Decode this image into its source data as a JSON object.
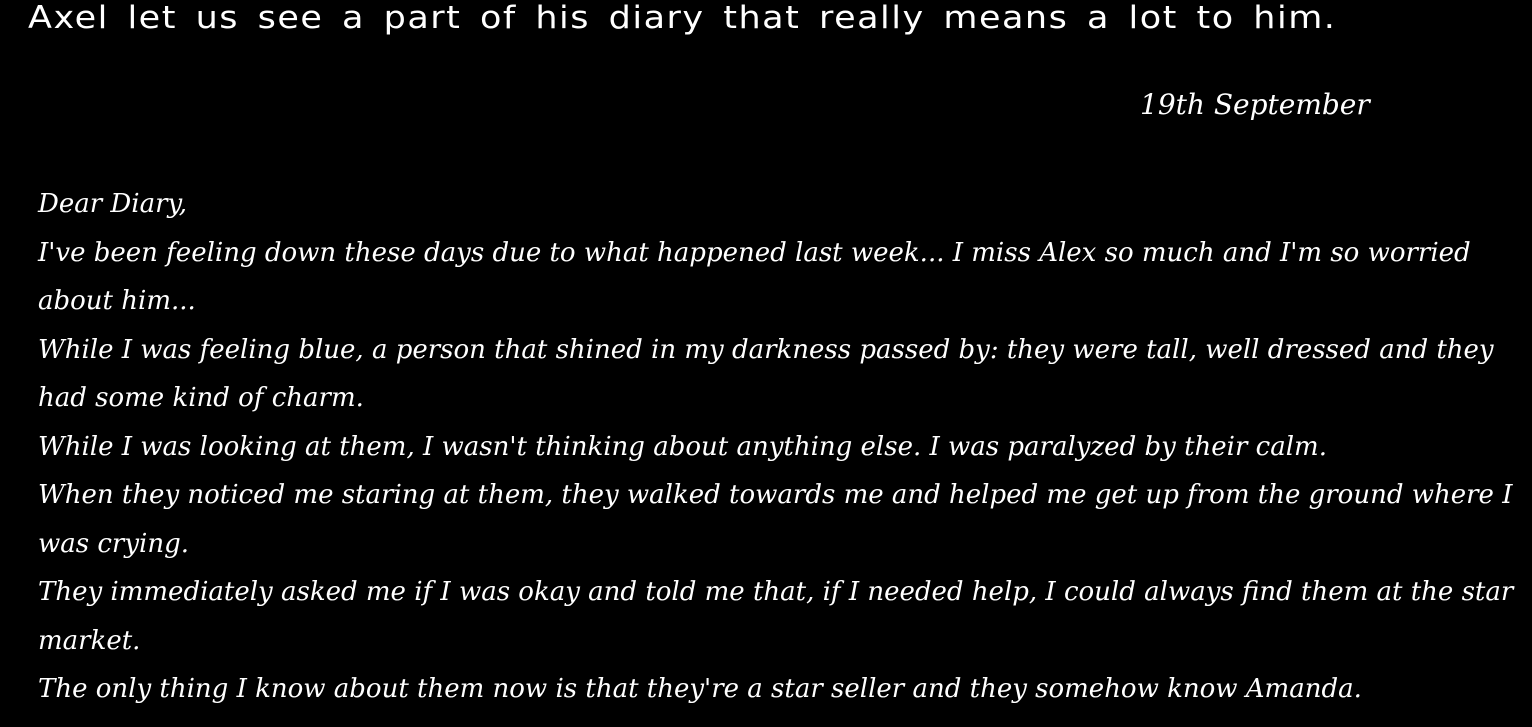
{
  "header": {
    "text": "Axel let us see a part of his diary that really means a lot to him."
  },
  "diary": {
    "date": "19th September",
    "greeting": "Dear Diary,",
    "lines": [
      "I've been feeling down these days due to what happened last week... I miss Alex so much and I'm so worried about him...",
      "While I was feeling blue, a person that shined in my darkness passed by: they were tall, well dressed and they had some kind of charm.",
      "While I was looking at them, I wasn't thinking about anything else. I was paralyzed by their calm.",
      "When they noticed me staring at them, they walked towards me and  helped me get up from the ground where I was crying.",
      "They immediately asked me if I was okay and told me that, if I needed help, I could always find them at the star market.",
      "The only thing I know about them now is that they're a star seller and they somehow know Amanda."
    ]
  }
}
